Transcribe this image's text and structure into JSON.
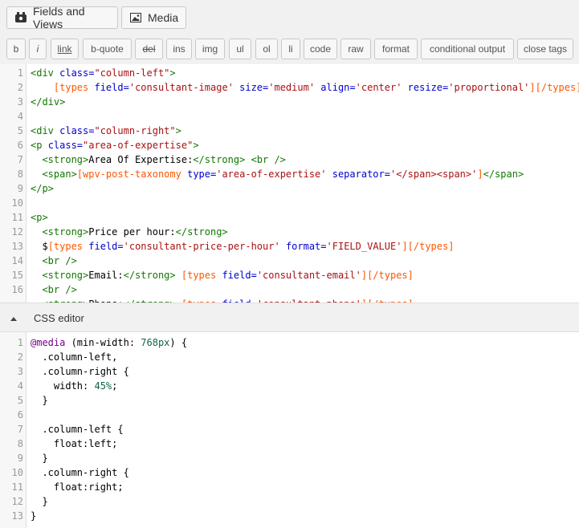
{
  "tabs": {
    "fields_views": "Fields and Views",
    "media": "Media"
  },
  "toolbar": {
    "buttons": [
      "b",
      "i",
      "link",
      "b-quote",
      "del",
      "ins",
      "img",
      "ul",
      "ol",
      "li",
      "code",
      "raw",
      "format",
      "conditional output",
      "close tags"
    ]
  },
  "html_editor": {
    "line_numbers": [
      "1",
      "2",
      "3",
      "4",
      "5",
      "6",
      "7",
      "8",
      "9",
      "10",
      "11",
      "12",
      "13",
      "14",
      "15",
      "16"
    ],
    "lines": [
      [
        [
          "tag",
          "<div "
        ],
        [
          "attr",
          "class="
        ],
        [
          "str",
          "\"column-left\""
        ],
        [
          "tag",
          ">"
        ]
      ],
      [
        [
          "plain",
          "    "
        ],
        [
          "sc",
          "[types "
        ],
        [
          "attr",
          "field="
        ],
        [
          "str",
          "'consultant-image'"
        ],
        [
          "plain",
          " "
        ],
        [
          "attr",
          "size="
        ],
        [
          "str",
          "'medium'"
        ],
        [
          "plain",
          " "
        ],
        [
          "attr",
          "align="
        ],
        [
          "str",
          "'center'"
        ],
        [
          "plain",
          " "
        ],
        [
          "attr",
          "resize="
        ],
        [
          "str",
          "'proportional'"
        ],
        [
          "sc",
          "][/types]"
        ]
      ],
      [
        [
          "tag",
          "</div>"
        ]
      ],
      [],
      [
        [
          "tag",
          "<div "
        ],
        [
          "attr",
          "class="
        ],
        [
          "str",
          "\"column-right\""
        ],
        [
          "tag",
          ">"
        ]
      ],
      [
        [
          "tag",
          "<p "
        ],
        [
          "attr",
          "class="
        ],
        [
          "str",
          "\"area-of-expertise\""
        ],
        [
          "tag",
          ">"
        ]
      ],
      [
        [
          "plain",
          "  "
        ],
        [
          "tag",
          "<strong>"
        ],
        [
          "plain",
          "Area Of Expertise:"
        ],
        [
          "tag",
          "</strong>"
        ],
        [
          "plain",
          " "
        ],
        [
          "tag",
          "<br />"
        ]
      ],
      [
        [
          "plain",
          "  "
        ],
        [
          "tag",
          "<span>"
        ],
        [
          "sc",
          "[wpv-post-taxonomy "
        ],
        [
          "attr",
          "type="
        ],
        [
          "str",
          "'area-of-expertise'"
        ],
        [
          "plain",
          " "
        ],
        [
          "attr",
          "separator="
        ],
        [
          "str",
          "'</span><span>'"
        ],
        [
          "sc",
          "]"
        ],
        [
          "tag",
          "</span>"
        ]
      ],
      [
        [
          "tag",
          "</p>"
        ]
      ],
      [],
      [
        [
          "tag",
          "<p>"
        ]
      ],
      [
        [
          "plain",
          "  "
        ],
        [
          "tag",
          "<strong>"
        ],
        [
          "plain",
          "Price per hour:"
        ],
        [
          "tag",
          "</strong>"
        ]
      ],
      [
        [
          "plain",
          "  $"
        ],
        [
          "sc",
          "[types "
        ],
        [
          "attr",
          "field="
        ],
        [
          "str",
          "'consultant-price-per-hour'"
        ],
        [
          "plain",
          " "
        ],
        [
          "attr",
          "format="
        ],
        [
          "str",
          "'FIELD_VALUE'"
        ],
        [
          "sc",
          "][/types]"
        ]
      ],
      [
        [
          "plain",
          "  "
        ],
        [
          "tag",
          "<br />"
        ]
      ],
      [
        [
          "plain",
          "  "
        ],
        [
          "tag",
          "<strong>"
        ],
        [
          "plain",
          "Email:"
        ],
        [
          "tag",
          "</strong>"
        ],
        [
          "plain",
          " "
        ],
        [
          "sc",
          "[types "
        ],
        [
          "attr",
          "field="
        ],
        [
          "str",
          "'consultant-email'"
        ],
        [
          "sc",
          "][/types]"
        ]
      ],
      [
        [
          "plain",
          "  "
        ],
        [
          "tag",
          "<br />"
        ]
      ]
    ],
    "partial_line": [
      [
        "plain",
        "  "
      ],
      [
        "tag",
        "<strong>"
      ],
      [
        "plain",
        "Phone:"
      ],
      [
        "tag",
        "</strong>"
      ],
      [
        "plain",
        " "
      ],
      [
        "sc",
        "[types "
      ],
      [
        "attr",
        "field="
      ],
      [
        "str",
        "'consultant-phone'"
      ],
      [
        "sc",
        "][/types]"
      ]
    ]
  },
  "css_editor": {
    "title": "CSS editor",
    "line_numbers": [
      "1",
      "2",
      "3",
      "4",
      "5",
      "6",
      "7",
      "8",
      "9",
      "10",
      "11",
      "12",
      "13"
    ],
    "lines": [
      [
        [
          "kw",
          "@media"
        ],
        [
          "plain",
          " (min-width: "
        ],
        [
          "num",
          "768px"
        ],
        [
          "plain",
          ") {"
        ]
      ],
      [
        [
          "plain",
          "  .column-left,"
        ]
      ],
      [
        [
          "plain",
          "  .column-right {"
        ]
      ],
      [
        [
          "plain",
          "    width: "
        ],
        [
          "num",
          "45%"
        ],
        [
          "plain",
          ";"
        ]
      ],
      [
        [
          "plain",
          "  }"
        ]
      ],
      [],
      [
        [
          "plain",
          "  .column-left {"
        ]
      ],
      [
        [
          "plain",
          "    float:left;"
        ]
      ],
      [
        [
          "plain",
          "  }"
        ]
      ],
      [
        [
          "plain",
          "  .column-right {"
        ]
      ],
      [
        [
          "plain",
          "    float:right;"
        ]
      ],
      [
        [
          "plain",
          "  }"
        ]
      ],
      [
        [
          "plain",
          "}"
        ]
      ]
    ]
  }
}
